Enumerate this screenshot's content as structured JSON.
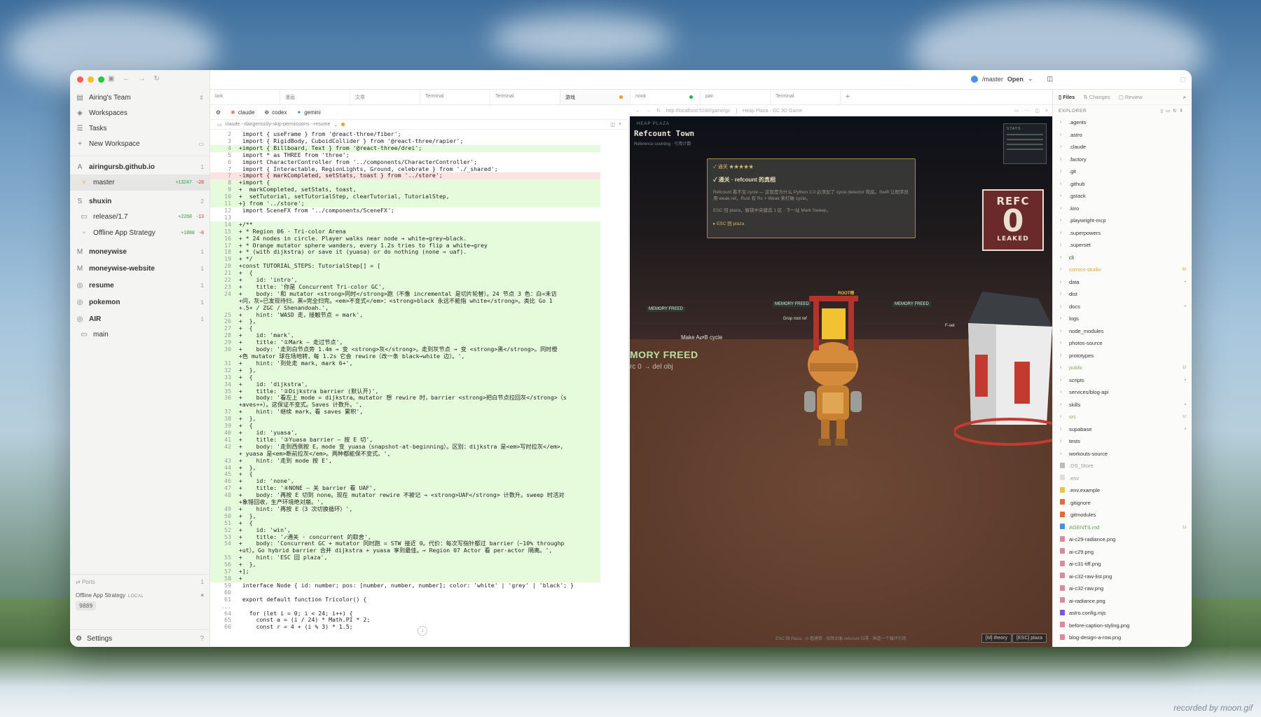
{
  "sidebar": {
    "team": "Airing's Team",
    "nav": [
      "Workspaces",
      "Tasks",
      "New Workspace"
    ],
    "workspaces": [
      {
        "name": "airingursb.github.io",
        "count": "1",
        "children": [
          {
            "name": "master",
            "add": "+13247",
            "del": "-28",
            "selected": true
          }
        ]
      },
      {
        "name": "shuxin",
        "count": "2",
        "children": [
          {
            "name": "release/1.7",
            "add": "+2268",
            "del": "-13"
          },
          {
            "name": "Offline App Strategy",
            "add": "+1888",
            "del": "-8"
          }
        ]
      },
      {
        "name": "moneywise",
        "count": "1",
        "children": []
      },
      {
        "name": "moneywise-website",
        "count": "1",
        "children": []
      },
      {
        "name": "resume",
        "count": "1",
        "children": []
      },
      {
        "name": "pokemon",
        "count": "1",
        "children": []
      },
      {
        "name": "AIR",
        "count": "1",
        "children": [
          {
            "name": "main"
          }
        ]
      }
    ],
    "ports": {
      "title": "Ports",
      "count": "1",
      "app": "Offline App Strategy",
      "tag": "LOCAL",
      "port": "9889"
    },
    "settings": "Settings"
  },
  "topbar": {
    "branch": "/master",
    "open_label": "Open"
  },
  "tabs": [
    {
      "label": "lark",
      "dot": ""
    },
    {
      "label": "漫画",
      "dot": ""
    },
    {
      "label": "文章",
      "dot": ""
    },
    {
      "label": "Terminal",
      "dot": ""
    },
    {
      "label": "Terminal",
      "dot": ""
    },
    {
      "label": "游戏",
      "dot": "#f59a23",
      "active": true
    },
    {
      "label": "nook",
      "dot": "#22b24c"
    },
    {
      "label": "pan",
      "dot": ""
    },
    {
      "label": "Terminal",
      "dot": ""
    }
  ],
  "agents": [
    "claude",
    "codex",
    "gemini"
  ],
  "editor": {
    "command": "claude --dangerously-skip-permissions --resume",
    "lines": [
      {
        "n": "2",
        "t": "  import { useFrame } from '@react-three/fiber';",
        "k": ""
      },
      {
        "n": "3",
        "t": "  import { RigidBody, CuboidCollider } from '@react-three/rapier';",
        "k": ""
      },
      {
        "n": "4",
        "t": " +import { Billboard, Text } from '@react-three/drei';",
        "k": "add"
      },
      {
        "n": "5",
        "t": "  import * as THREE from 'three';",
        "k": ""
      },
      {
        "n": "6",
        "t": "  import CharacterController from '../components/CharacterController';",
        "k": ""
      },
      {
        "n": "7",
        "t": "  import { Interactable, RegionLights, Ground, celebrate } from './_shared';",
        "k": ""
      },
      {
        "n": "7",
        "t": " -import { markCompleted, setStats, toast } from '../store';",
        "k": "del"
      },
      {
        "n": "8",
        "t": " +import {",
        "k": "add"
      },
      {
        "n": "9",
        "t": " +  markCompleted, setStats, toast,",
        "k": "add"
      },
      {
        "n": "10",
        "t": " +  setTutorial, setTutorialStep, clearTutorial, TutorialStep,",
        "k": "add"
      },
      {
        "n": "11",
        "t": " +} from '../store';",
        "k": "add"
      },
      {
        "n": "12",
        "t": "  import SceneFX from '../components/SceneFX';",
        "k": ""
      },
      {
        "n": "13",
        "t": "",
        "k": ""
      },
      {
        "n": "14",
        "t": " +/**",
        "k": "add"
      },
      {
        "n": "15",
        "t": " + * Region 06 · Tri-color Arena",
        "k": "add"
      },
      {
        "n": "16",
        "t": " + * 24 nodes in circle. Player walks near node → white→grey→black.",
        "k": "add"
      },
      {
        "n": "17",
        "t": " + * Orange mutator sphere wanders, every 1.2s tries to flip a white→grey",
        "k": "add"
      },
      {
        "n": "18",
        "t": " + * (with dijkstra) or save it (yuasa) or do nothing (none → uaf).",
        "k": "add"
      },
      {
        "n": "19",
        "t": " + */",
        "k": "add"
      },
      {
        "n": "20",
        "t": " +const TUTORIAL_STEPS: TutorialStep[] = [",
        "k": "add"
      },
      {
        "n": "21",
        "t": " +  {",
        "k": "add"
      },
      {
        "n": "22",
        "t": " +    id: 'intro',",
        "k": "add"
      },
      {
        "n": "23",
        "t": " +    title: '你是 Concurrent Tri-color GC',",
        "k": "add"
      },
      {
        "n": "24",
        "t": " +    body: '和 mutator <strong>同时</strong>跑（不像 incremental 是切片轮替）。24 节点 3 色：白=未访",
        "k": "add"
      },
      {
        "n": "",
        "t": " +问，灰=已发现待扫，黑=完全扫完。<em>不变式</em>：<strong>black 永远不能指 white</strong>。类比 Go 1",
        "k": "add"
      },
      {
        "n": "",
        "t": " +.5+ / ZGC / Shenandoah.',",
        "k": "add"
      },
      {
        "n": "25",
        "t": " +    hint: 'WASD 走，接触节点 = mark',",
        "k": "add"
      },
      {
        "n": "26",
        "t": " +  },",
        "k": "add"
      },
      {
        "n": "27",
        "t": " +  {",
        "k": "add"
      },
      {
        "n": "28",
        "t": " +    id: 'mark',",
        "k": "add"
      },
      {
        "n": "29",
        "t": " +    title: '①Mark — 走过节点',",
        "k": "add"
      },
      {
        "n": "30",
        "t": " +    body: '走到白节点旁 1.4m → 变 <strong>灰</strong>。走到灰节点 → 变 <strong>黑</strong>。同时橙",
        "k": "add"
      },
      {
        "n": "",
        "t": " +色 mutator 球在场地转，每 1.2s 它会 rewire（改一条 black→white 边）。',",
        "k": "add"
      },
      {
        "n": "31",
        "t": " +    hint: '到处走 mark, mark 6+',",
        "k": "add"
      },
      {
        "n": "32",
        "t": " +  },",
        "k": "add"
      },
      {
        "n": "33",
        "t": " +  {",
        "k": "add"
      },
      {
        "n": "34",
        "t": " +    id: 'dijkstra',",
        "k": "add"
      },
      {
        "n": "35",
        "t": " +    title: '②Dijkstra barrier (默认开)',",
        "k": "add"
      },
      {
        "n": "36",
        "t": " +    body: '看左上 mode = dijkstra。mutator 想 rewire 时，barrier <strong>把白节点拉回灰</strong>（s",
        "k": "add"
      },
      {
        "n": "",
        "t": " +aves++）。这保证不变式。Saves 计数升。',",
        "k": "add"
      },
      {
        "n": "37",
        "t": " +    hint: '继续 mark，看 saves 累积',",
        "k": "add"
      },
      {
        "n": "38",
        "t": " +  },",
        "k": "add"
      },
      {
        "n": "39",
        "t": " +  {",
        "k": "add"
      },
      {
        "n": "40",
        "t": " +    id: 'yuasa',",
        "k": "add"
      },
      {
        "n": "41",
        "t": " +    title: '③Yuasa barrier — 按 E 切',",
        "k": "add"
      },
      {
        "n": "42",
        "t": " +    body: '走到西侧按 E，mode 变 yuasa（snapshot-at-beginning）。区别：dijkstra 是<em>写时拉灰</em>，",
        "k": "add"
      },
      {
        "n": "",
        "t": " + yuasa 是<em>断前拉灰</em>。两种都能保不变式。',",
        "k": "add"
      },
      {
        "n": "43",
        "t": " +    hint: '走到 mode 按 E',",
        "k": "add"
      },
      {
        "n": "44",
        "t": " +  },",
        "k": "add"
      },
      {
        "n": "45",
        "t": " +  {",
        "k": "add"
      },
      {
        "n": "46",
        "t": " +    id: 'none',",
        "k": "add"
      },
      {
        "n": "47",
        "t": " +    title: '④NONE — 关 barrier 看 UAF',",
        "k": "add"
      },
      {
        "n": "48",
        "t": " +    body: '再按 E 切到 none。现在 mutator rewire 不被记 → <strong>UAF</strong> 计数升。sweep 时活对",
        "k": "add"
      },
      {
        "n": "",
        "t": " +象错回收，生产环境绝对崩。',",
        "k": "add"
      },
      {
        "n": "49",
        "t": " +    hint: '再按 E（3 次切换循环）',",
        "k": "add"
      },
      {
        "n": "50",
        "t": " +  },",
        "k": "add"
      },
      {
        "n": "51",
        "t": " +  {",
        "k": "add"
      },
      {
        "n": "52",
        "t": " +    id: 'win',",
        "k": "add"
      },
      {
        "n": "53",
        "t": " +    title: '✓通关 · concurrent 的取舍',",
        "k": "add"
      },
      {
        "n": "54",
        "t": " +    body: 'Concurrent GC + mutator 同时跑 = STW 接近 0。代价：每次写指针都过 barrier（~10% throughp",
        "k": "add"
      },
      {
        "n": "",
        "t": " +ut）。Go hybrid barrier 合并 dijkstra + yuasa 享到最佳。→ Region 07 Actor 看 per-actor 隔离。',",
        "k": "add"
      },
      {
        "n": "55",
        "t": " +    hint: 'ESC 回 plaza',",
        "k": "add"
      },
      {
        "n": "56",
        "t": " +  },",
        "k": "add"
      },
      {
        "n": "57",
        "t": " +];",
        "k": "add"
      },
      {
        "n": "58",
        "t": " +",
        "k": "add"
      },
      {
        "n": "59",
        "t": "  interface Node { id: number; pos: [number, number, number]; color: 'white' | 'grey' | 'black'; }",
        "k": ""
      },
      {
        "n": "60",
        "t": "",
        "k": ""
      },
      {
        "n": "61",
        "t": "  export default function Tricolor() {",
        "k": ""
      },
      {
        "n": "...",
        "t": "",
        "k": ""
      },
      {
        "n": "64",
        "t": "    for (let i = 0; i < 24; i++) {",
        "k": ""
      },
      {
        "n": "65",
        "t": "      const a = (i / 24) * Math.PI * 2;",
        "k": ""
      },
      {
        "n": "66",
        "t": "      const r = 4 + (i % 3) * 1.5;",
        "k": ""
      }
    ]
  },
  "preview": {
    "url": "http://localhost:5180/game/gc",
    "page_title": "Heap Plaza · GC 3D Game",
    "hud_label": "HEAP PLAZA",
    "hud_title": "Refcount Town",
    "hud_sub": "Reference counting · 引用计数",
    "stats_title": "STATS",
    "dialog": {
      "tag": "通关",
      "title": "✓ 通关 · refcount 的真相",
      "body": "Refcount 看不见 cycle — 这就是为什么 Python 2.0 必须加了 cycle detector 兜底。Swift 让程序员用 weak ref，Rust 有 Rc + Weak 来打破 cycle。",
      "body2": "ESC 回 plaza，解锁中央建造 1 区 · 下一站 Mark Sweep。",
      "esc": "▸ ESC 回 plaza"
    },
    "refc": {
      "t1": "REFC",
      "t2": "0",
      "t3": "LEAKED"
    },
    "mem_freed": "MORY FREED",
    "del_obj": "rc 0 → del obj",
    "labels": [
      "MEMORY FREED",
      "MEMORY FREED",
      "MEMORY FREED",
      "ROOT根",
      "Drop root ref",
      "Make A⇄B cycle",
      "F-set"
    ],
    "bottom": "ESC 回 Plaza · ⊙ 看建筑 · 扣除对象 refcount 归零 · 再造一个循环引用",
    "btn_theory": "[M] theory",
    "btn_plaza": "[ESC] plaza"
  },
  "explorer": {
    "tabs": [
      "Files",
      "Changes",
      "Review"
    ],
    "header": "EXPLORER",
    "items": [
      {
        "name": ".agents",
        "type": "dir",
        "color": "#333",
        "status": ""
      },
      {
        "name": ".astro",
        "type": "dir",
        "color": "#333",
        "status": ""
      },
      {
        "name": ".claude",
        "type": "dir",
        "color": "#333",
        "status": ""
      },
      {
        "name": ".factory",
        "type": "dir",
        "color": "#333",
        "status": ""
      },
      {
        "name": ".git",
        "type": "dir",
        "color": "#333",
        "status": ""
      },
      {
        "name": ".github",
        "type": "dir",
        "color": "#333",
        "status": ""
      },
      {
        "name": ".gstack",
        "type": "dir",
        "color": "#333",
        "status": ""
      },
      {
        "name": ".kiro",
        "type": "dir",
        "color": "#333",
        "status": ""
      },
      {
        "name": ".playwright-mcp",
        "type": "dir",
        "color": "#333",
        "status": ""
      },
      {
        "name": ".superpowers",
        "type": "dir",
        "color": "#333",
        "status": ""
      },
      {
        "name": ".superset",
        "type": "dir",
        "color": "#333",
        "status": ""
      },
      {
        "name": "cli",
        "type": "dir",
        "color": "#333",
        "status": ""
      },
      {
        "name": "comics-studio",
        "type": "dir",
        "color": "#d9a441",
        "status": "M"
      },
      {
        "name": "data",
        "type": "dir",
        "color": "#333",
        "status": "•"
      },
      {
        "name": "dist",
        "type": "dir",
        "color": "#333",
        "status": ""
      },
      {
        "name": "docs",
        "type": "dir",
        "color": "#333",
        "status": "•"
      },
      {
        "name": "logs",
        "type": "dir",
        "color": "#333",
        "status": ""
      },
      {
        "name": "node_modules",
        "type": "dir",
        "color": "#333",
        "status": ""
      },
      {
        "name": "photos-source",
        "type": "dir",
        "color": "#333",
        "status": ""
      },
      {
        "name": "prototypes",
        "type": "dir",
        "color": "#333",
        "status": ""
      },
      {
        "name": "public",
        "type": "dir",
        "color": "#7fae5a",
        "status": "U"
      },
      {
        "name": "scripts",
        "type": "dir",
        "color": "#333",
        "status": "•"
      },
      {
        "name": "services/blog-api",
        "type": "dir",
        "color": "#333",
        "status": ""
      },
      {
        "name": "skills",
        "type": "dir",
        "color": "#333",
        "status": "•"
      },
      {
        "name": "src",
        "type": "dir",
        "color": "#7fae5a",
        "status": "U"
      },
      {
        "name": "supabase",
        "type": "dir",
        "color": "#333",
        "status": "•"
      },
      {
        "name": "tests",
        "type": "dir",
        "color": "#333",
        "status": ""
      },
      {
        "name": "workouts-source",
        "type": "dir",
        "color": "#333",
        "status": ""
      },
      {
        "name": ".DS_Store",
        "type": "file",
        "color": "#999",
        "status": "",
        "ic": "#bbb"
      },
      {
        "name": ".env",
        "type": "file",
        "color": "#999",
        "status": "",
        "ic": "#ddd"
      },
      {
        "name": ".env.example",
        "type": "file",
        "color": "#333",
        "status": "",
        "ic": "#e4c74b"
      },
      {
        "name": ".gitignore",
        "type": "file",
        "color": "#333",
        "status": "",
        "ic": "#e06c3c"
      },
      {
        "name": ".gitmodules",
        "type": "file",
        "color": "#333",
        "status": "",
        "ic": "#e06c3c"
      },
      {
        "name": "AGENTS.md",
        "type": "file",
        "color": "#5aa14a",
        "status": "U",
        "ic": "#4a8fd8"
      },
      {
        "name": "ai-c29-radiance.png",
        "type": "file",
        "color": "#333",
        "status": "",
        "ic": "#d88aa0"
      },
      {
        "name": "ai-c29.png",
        "type": "file",
        "color": "#333",
        "status": "",
        "ic": "#d88aa0"
      },
      {
        "name": "ai-c31-tiff.png",
        "type": "file",
        "color": "#333",
        "status": "",
        "ic": "#d88aa0"
      },
      {
        "name": "ai-c32-raw-list.png",
        "type": "file",
        "color": "#333",
        "status": "",
        "ic": "#d88aa0"
      },
      {
        "name": "ai-c32-raw.png",
        "type": "file",
        "color": "#333",
        "status": "",
        "ic": "#d88aa0"
      },
      {
        "name": "ai-radiance.png",
        "type": "file",
        "color": "#333",
        "status": "",
        "ic": "#d88aa0"
      },
      {
        "name": "astro.config.mjs",
        "type": "file",
        "color": "#333",
        "status": "",
        "ic": "#7a5ad8"
      },
      {
        "name": "before-caption-styling.png",
        "type": "file",
        "color": "#333",
        "status": "",
        "ic": "#d88aa0"
      },
      {
        "name": "blog-design-a-row.png",
        "type": "file",
        "color": "#333",
        "status": "",
        "ic": "#d88aa0"
      }
    ]
  },
  "watermark": "recorded by moon.gif",
  "colors": {
    "accent": "#22a34a",
    "del": "#d33b3b",
    "orange": "#f59a23"
  }
}
